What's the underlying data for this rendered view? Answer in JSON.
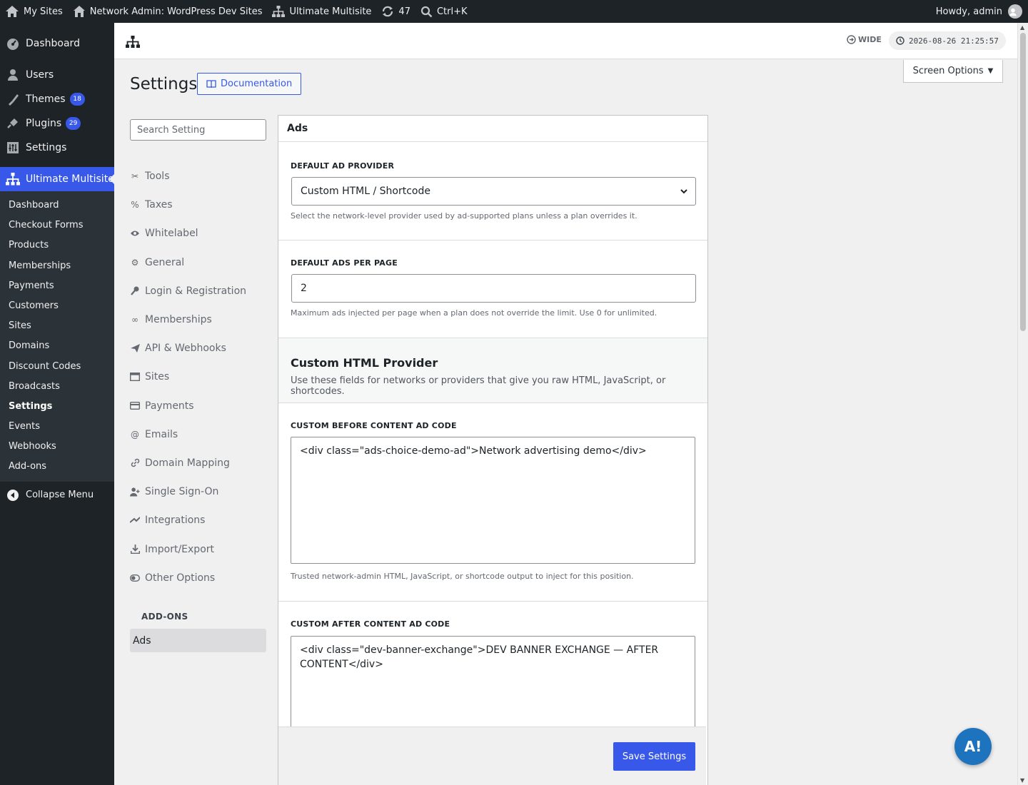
{
  "adminbar": {
    "my_sites": "My Sites",
    "network_admin": "Network Admin: WordPress Dev Sites",
    "plugin_name": "Ultimate Multisite",
    "updates_count": "47",
    "search_shortcut": "Ctrl+K",
    "howdy": "Howdy, admin"
  },
  "menu": {
    "dashboard": "Dashboard",
    "users": "Users",
    "themes": "Themes",
    "themes_badge": "18",
    "plugins": "Plugins",
    "plugins_badge": "29",
    "settings": "Settings",
    "ultimate_multisite": "Ultimate Multisite",
    "submenu": [
      "Dashboard",
      "Checkout Forms",
      "Products",
      "Memberships",
      "Payments",
      "Customers",
      "Sites",
      "Domains",
      "Discount Codes",
      "Broadcasts",
      "Settings",
      "Events",
      "Webhooks",
      "Add-ons"
    ],
    "collapse": "Collapse Menu"
  },
  "topbar": {
    "wide_label": "WIDE",
    "clock": "2026-08-26 21:25:57"
  },
  "screen_options": "Screen Options",
  "page": {
    "title": "Settings",
    "documentation": "Documentation",
    "search_placeholder": "Search Setting"
  },
  "settings_nav": [
    {
      "label": "Tools",
      "icon": "tools-icon"
    },
    {
      "label": "Taxes",
      "icon": "percent-icon"
    },
    {
      "label": "Whitelabel",
      "icon": "eye-icon"
    },
    {
      "label": "General",
      "icon": "gear-icon"
    },
    {
      "label": "Login & Registration",
      "icon": "key-icon"
    },
    {
      "label": "Memberships",
      "icon": "infinity-icon"
    },
    {
      "label": "API & Webhooks",
      "icon": "send-icon"
    },
    {
      "label": "Sites",
      "icon": "browser-icon"
    },
    {
      "label": "Payments",
      "icon": "credit-card-icon"
    },
    {
      "label": "Emails",
      "icon": "at-icon"
    },
    {
      "label": "Domain Mapping",
      "icon": "link-icon"
    },
    {
      "label": "Single Sign-On",
      "icon": "user-plus-icon"
    },
    {
      "label": "Integrations",
      "icon": "integration-icon"
    },
    {
      "label": "Import/Export",
      "icon": "download-icon"
    },
    {
      "label": "Other Options",
      "icon": "toggle-icon"
    }
  ],
  "addons_heading": "ADD-ONS",
  "addons_active": "Ads",
  "panel": {
    "title": "Ads",
    "default_ad_provider": {
      "label": "DEFAULT AD PROVIDER",
      "value": "Custom HTML / Shortcode",
      "help": "Select the network-level provider used by ad-supported plans unless a plan overrides it."
    },
    "default_ads_per_page": {
      "label": "DEFAULT ADS PER PAGE",
      "value": "2",
      "help": "Maximum ads injected per page when a plan does not override the limit. Use 0 for unlimited."
    },
    "custom_html_provider": {
      "title": "Custom HTML Provider",
      "description": "Use these fields for networks or providers that give you raw HTML, JavaScript, or shortcodes."
    },
    "before_content": {
      "label": "CUSTOM BEFORE CONTENT AD CODE",
      "value": "<div class=\"ads-choice-demo-ad\">Network advertising demo</div>",
      "help": "Trusted network-admin HTML, JavaScript, or shortcode output to inject for this position."
    },
    "after_content": {
      "label": "CUSTOM AFTER CONTENT AD CODE",
      "value": "<div class=\"dev-banner-exchange\">DEV BANNER EXCHANGE — AFTER CONTENT</div>"
    },
    "save": "Save Settings"
  },
  "fab_label": "A!",
  "colors": {
    "accent": "#3858e9",
    "adminbar_bg": "#1d2327",
    "fab": "#1e73be"
  }
}
